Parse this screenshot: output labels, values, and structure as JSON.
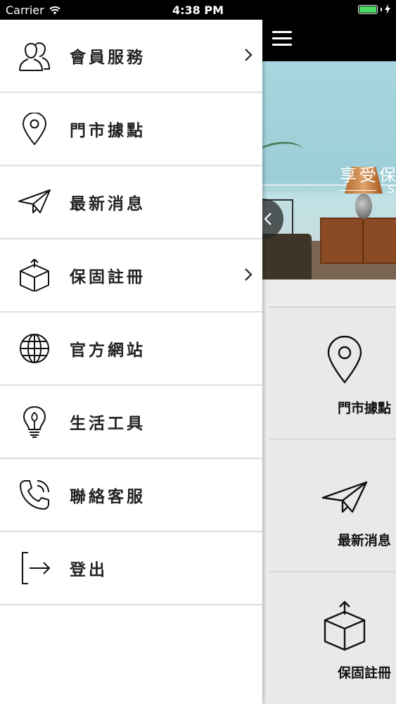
{
  "status_bar": {
    "carrier": "Carrier",
    "time": "4:38 PM"
  },
  "menu": {
    "items": [
      {
        "label": "會員服務",
        "icon": "members-icon",
        "has_submenu": true
      },
      {
        "label": "門市據點",
        "icon": "location-pin-icon",
        "has_submenu": false
      },
      {
        "label": "最新消息",
        "icon": "paper-plane-icon",
        "has_submenu": false
      },
      {
        "label": "保固註冊",
        "icon": "box-icon",
        "has_submenu": true
      },
      {
        "label": "官方網站",
        "icon": "globe-icon",
        "has_submenu": false
      },
      {
        "label": "生活工具",
        "icon": "lightbulb-icon",
        "has_submenu": false
      },
      {
        "label": "聯絡客服",
        "icon": "phone-icon",
        "has_submenu": false
      },
      {
        "label": "登出",
        "icon": "logout-icon",
        "has_submenu": false
      }
    ]
  },
  "banner": {
    "tagline": "享受保",
    "tagline_sub": "S"
  },
  "tiles": [
    {
      "label": "門市據點",
      "icon": "location-pin-icon"
    },
    {
      "label": "最新消息",
      "icon": "paper-plane-icon"
    },
    {
      "label": "保固註冊",
      "icon": "box-icon"
    }
  ],
  "colors": {
    "battery": "#4cd964",
    "topbar": "#000000",
    "tile_bg": "#e9e9ec"
  }
}
